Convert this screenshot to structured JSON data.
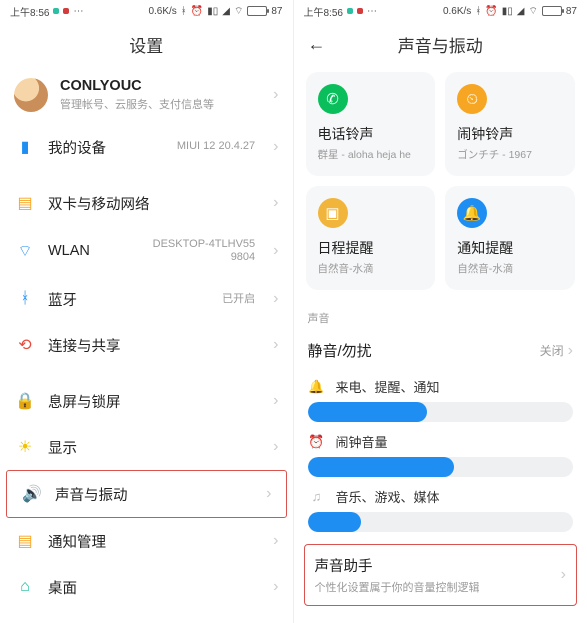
{
  "statusbar": {
    "time": "上午8:56",
    "net": "0.6K/s",
    "battery": "87"
  },
  "left": {
    "title": "设置",
    "profile": {
      "name": "CONLYOUC",
      "sub": "管理帐号、云服务、支付信息等"
    },
    "device": {
      "label": "我的设备",
      "value": "MIUI 12 20.4.27"
    },
    "items": {
      "sim": {
        "label": "双卡与移动网络"
      },
      "wlan": {
        "label": "WLAN",
        "value": "DESKTOP-4TLHV55\n9804"
      },
      "bt": {
        "label": "蓝牙",
        "value": "已开启"
      },
      "share": {
        "label": "连接与共享"
      },
      "lock": {
        "label": "息屏与锁屏"
      },
      "display": {
        "label": "显示"
      },
      "sound": {
        "label": "声音与振动"
      },
      "notif": {
        "label": "通知管理"
      },
      "home": {
        "label": "桌面"
      }
    }
  },
  "right": {
    "title": "声音与振动",
    "cards": {
      "ringtone": {
        "title": "电话铃声",
        "sub": "群星 - aloha heja he"
      },
      "alarm": {
        "title": "闹钟铃声",
        "sub": "ゴンチチ - 1967"
      },
      "calendar": {
        "title": "日程提醒",
        "sub": "自然音-水滴"
      },
      "notice": {
        "title": "通知提醒",
        "sub": "自然音-水滴"
      }
    },
    "section": "声音",
    "silent": {
      "label": "静音/勿扰",
      "value": "关闭"
    },
    "sliders": {
      "ring": {
        "label": "来电、提醒、通知"
      },
      "alarm": {
        "label": "闹钟音量"
      },
      "media": {
        "label": "音乐、游戏、媒体"
      }
    },
    "assistant": {
      "title": "声音助手",
      "sub": "个性化设置属于你的音量控制逻辑"
    }
  },
  "chevron": "›",
  "back": "←",
  "chart_data": {
    "type": "bar",
    "title": "Volume levels",
    "series": [
      {
        "name": "来电、提醒、通知",
        "value": 45
      },
      {
        "name": "闹钟音量",
        "value": 55
      },
      {
        "name": "音乐、游戏、媒体",
        "value": 20
      }
    ],
    "ylim": [
      0,
      100
    ]
  }
}
